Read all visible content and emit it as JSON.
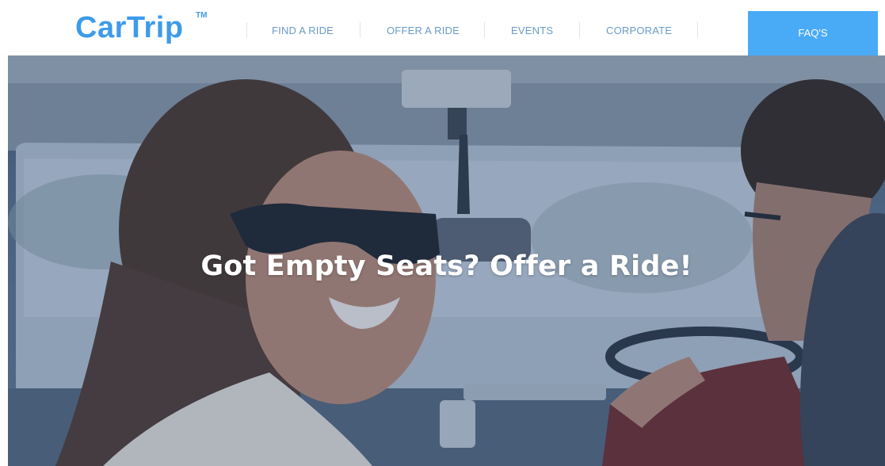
{
  "brand": {
    "name": "CarTrip",
    "trademark": "TM",
    "color": "#3d9be9"
  },
  "nav": {
    "items": [
      {
        "label": "FIND A RIDE"
      },
      {
        "label": "OFFER A RIDE"
      },
      {
        "label": "EVENTS"
      },
      {
        "label": "CORPORATE"
      }
    ],
    "faq_label": "FAQ'S",
    "faq_color": "#49aaf6"
  },
  "hero": {
    "heading": "Got Empty Seats? Offer a Ride!"
  }
}
